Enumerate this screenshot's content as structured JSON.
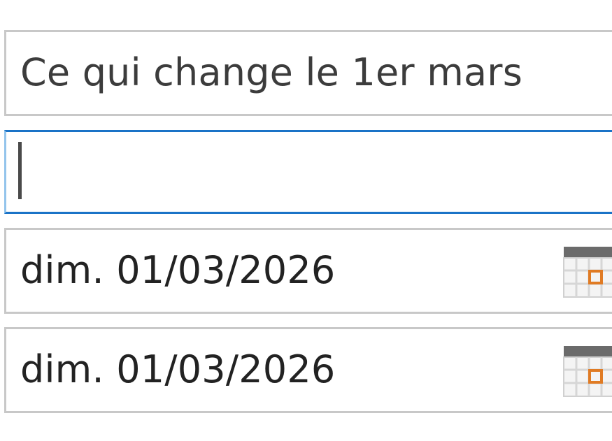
{
  "event_form": {
    "subject": {
      "value": "Ce qui change le 1er mars"
    },
    "location": {
      "value": "",
      "focused": true
    },
    "start_date": {
      "value": "dim. 01/03/2026",
      "icon": "calendar-icon"
    },
    "end_date": {
      "value": "dim. 01/03/2026",
      "icon": "calendar-icon"
    }
  },
  "colors": {
    "field_border": "#c8c8c8",
    "focus_border": "#1a73c7",
    "calendar_accent": "#e07b24",
    "calendar_header": "#6b6b6b"
  }
}
